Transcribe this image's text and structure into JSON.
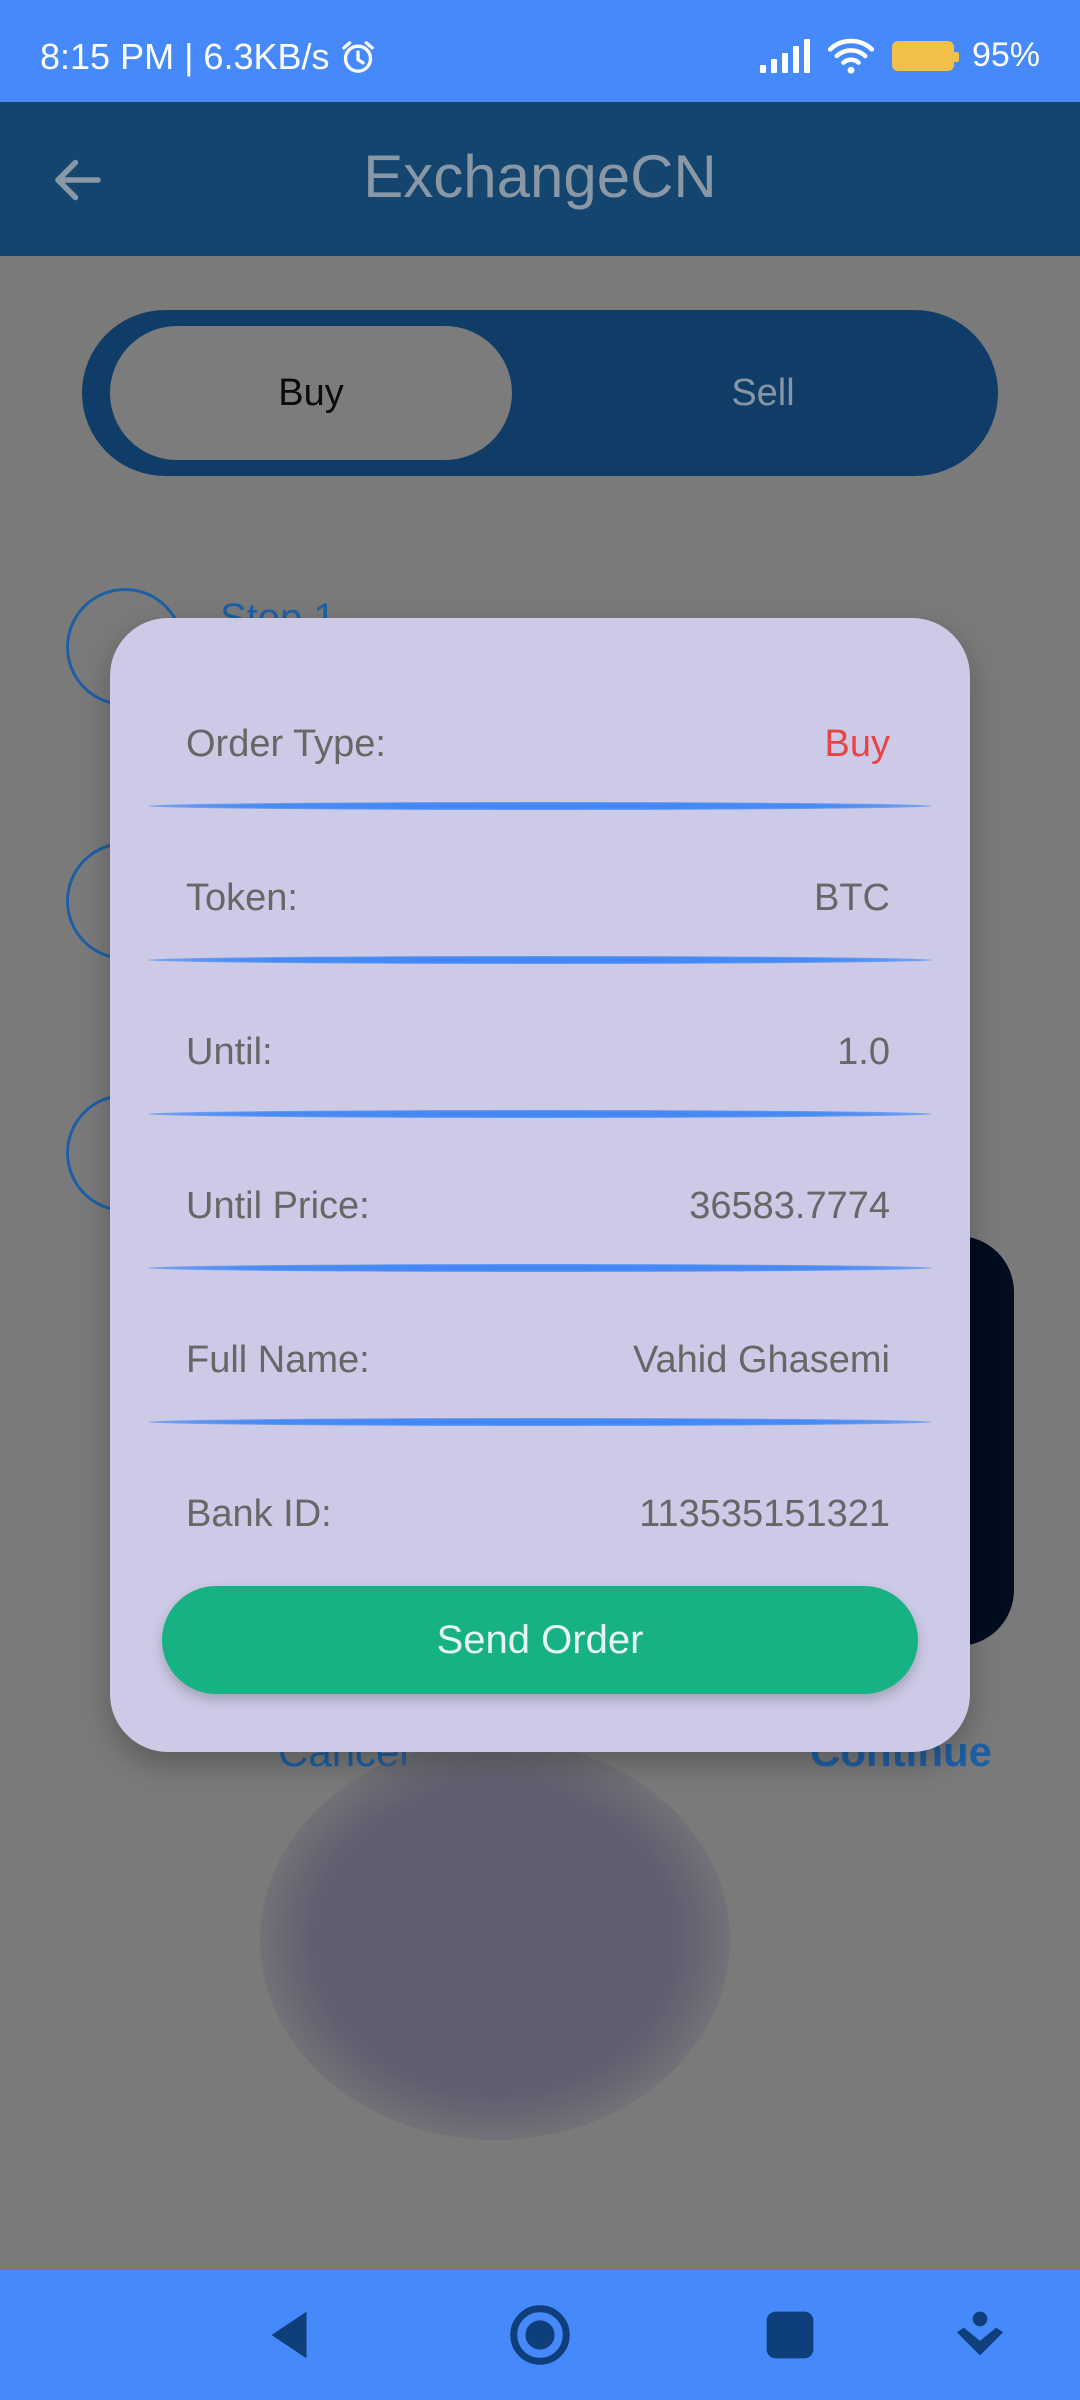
{
  "status_bar": {
    "time_info": "8:15 PM | 6.3KB/s",
    "battery": "95%",
    "icons": [
      "alarm-icon",
      "signal-icon",
      "wifi-icon",
      "battery-icon"
    ]
  },
  "app_bar": {
    "title": "ExchangeCN",
    "back_icon": "arrow-left-icon"
  },
  "toggle": {
    "buy_label": "Buy",
    "sell_label": "Sell",
    "selected": "Buy"
  },
  "background": {
    "step_label": "Step 1",
    "cancel_label": "Cancel",
    "continue_label": "Continue"
  },
  "dialog": {
    "rows": [
      {
        "label": "Order Type:",
        "value": "Buy"
      },
      {
        "label": "Token:",
        "value": "BTC"
      },
      {
        "label": "Until:",
        "value": "1.0"
      },
      {
        "label": "Until Price:",
        "value": "36583.7774"
      },
      {
        "label": "Full Name:",
        "value": "Vahid Ghasemi"
      },
      {
        "label": "Bank ID:",
        "value": "113535151321"
      }
    ],
    "send_button": "Send Order"
  },
  "nav_bar": {
    "icons": [
      "nav-back-icon",
      "nav-home-icon",
      "nav-recents-icon",
      "nav-assist-icon"
    ]
  },
  "colors": {
    "status_bar": "#4689fb",
    "app_bar_dimmed": "#13456f",
    "dialog_bg": "#cccae6",
    "divider": "#4a8cf4",
    "order_type_value": "#e84444",
    "send_button": "#16b283"
  }
}
